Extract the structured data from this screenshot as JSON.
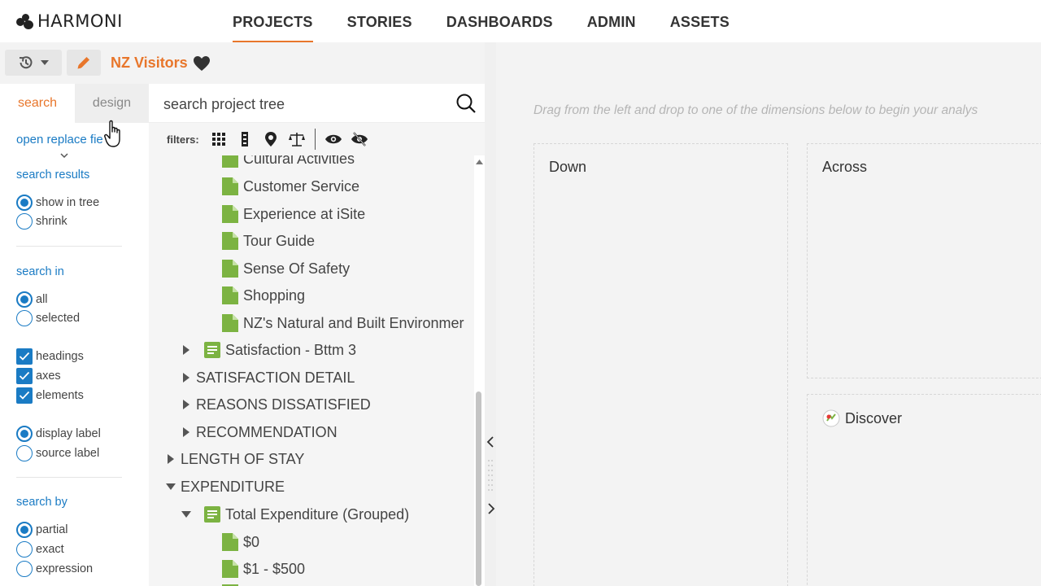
{
  "app": {
    "logo_text": "HARMONI",
    "nav": [
      {
        "label": "PROJECTS",
        "active": true
      },
      {
        "label": "STORIES",
        "active": false
      },
      {
        "label": "DASHBOARDS",
        "active": false
      },
      {
        "label": "ADMIN",
        "active": false
      },
      {
        "label": "ASSETS",
        "active": false
      }
    ],
    "accent_color": "#e8762b",
    "link_color": "#1a7bc4"
  },
  "project": {
    "title": "NZ Visitors",
    "history_icon": "history-icon",
    "edit_icon": "pencil-icon",
    "favorite_icon": "heart-icon"
  },
  "options": {
    "tabs": {
      "search": "search",
      "design": "design"
    },
    "open_replace": "open replace fie",
    "search_results_label": "search results",
    "results": [
      {
        "label": "show in tree",
        "selected": true
      },
      {
        "label": "shrink",
        "selected": false
      }
    ],
    "search_in_label": "search in",
    "search_in": [
      {
        "label": "all",
        "selected": true
      },
      {
        "label": "selected",
        "selected": false
      }
    ],
    "checks": [
      {
        "label": "headings",
        "checked": true
      },
      {
        "label": "axes",
        "checked": true
      },
      {
        "label": "elements",
        "checked": true
      }
    ],
    "label_type": [
      {
        "label": "display label",
        "selected": true
      },
      {
        "label": "source label",
        "selected": false
      }
    ],
    "search_by_label": "search by",
    "search_by": [
      {
        "label": "partial",
        "selected": true
      },
      {
        "label": "exact",
        "selected": false
      },
      {
        "label": "expression",
        "selected": false
      }
    ]
  },
  "tree": {
    "search_placeholder": "search project tree",
    "filters_label": "filters:",
    "filter_icons": [
      "grid-icon",
      "column-icon",
      "pin-icon",
      "balance-icon",
      "eye-icon",
      "eye-off-icon"
    ],
    "rows": [
      {
        "label": "Cultural Activities",
        "kind": "leaf"
      },
      {
        "label": "Customer Service",
        "kind": "leaf"
      },
      {
        "label": "Experience at iSite",
        "kind": "leaf"
      },
      {
        "label": "Tour Guide",
        "kind": "leaf"
      },
      {
        "label": "Sense Of Safety",
        "kind": "leaf"
      },
      {
        "label": "Shopping",
        "kind": "leaf"
      },
      {
        "label": "NZ's Natural and Built Environmer",
        "kind": "leaf"
      },
      {
        "label": "Satisfaction - Bttm 3",
        "kind": "variable",
        "expanded": false
      },
      {
        "label": "SATISFACTION DETAIL",
        "kind": "heading",
        "expanded": false
      },
      {
        "label": "REASONS DISSATISFIED",
        "kind": "heading",
        "expanded": false
      },
      {
        "label": "RECOMMENDATION",
        "kind": "heading",
        "expanded": false
      },
      {
        "label": "LENGTH OF STAY",
        "kind": "heading",
        "expanded": false
      },
      {
        "label": "EXPENDITURE",
        "kind": "heading",
        "expanded": true
      },
      {
        "label": "Total Expenditure (Grouped)",
        "kind": "variable",
        "expanded": true
      },
      {
        "label": "$0",
        "kind": "leaf"
      },
      {
        "label": "$1 - $500",
        "kind": "leaf"
      }
    ]
  },
  "workspace": {
    "hint": "Drag from the left and drop to one of the dimensions below to begin your analys",
    "zones": {
      "down": "Down",
      "across": "Across",
      "discover": "Discover"
    }
  }
}
